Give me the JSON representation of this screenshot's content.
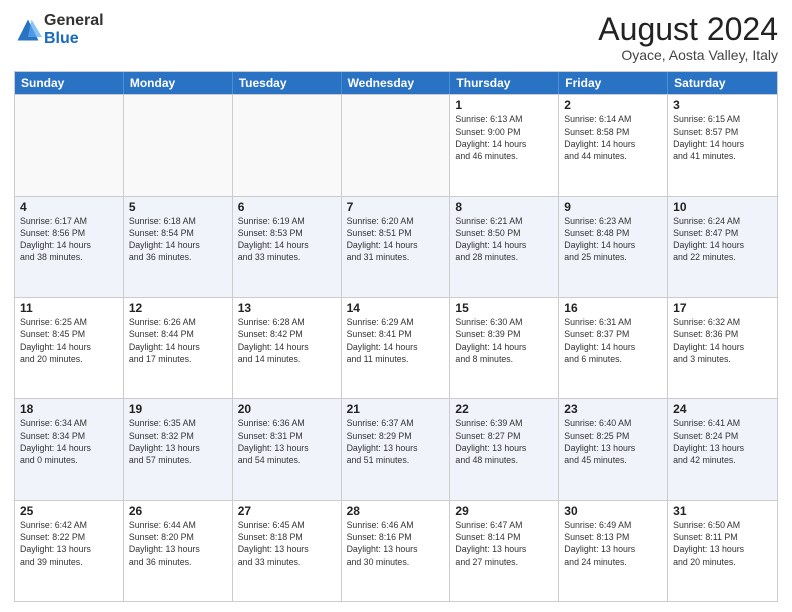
{
  "logo": {
    "general": "General",
    "blue": "Blue"
  },
  "title": "August 2024",
  "subtitle": "Oyace, Aosta Valley, Italy",
  "weekdays": [
    "Sunday",
    "Monday",
    "Tuesday",
    "Wednesday",
    "Thursday",
    "Friday",
    "Saturday"
  ],
  "rows": [
    [
      {
        "day": "",
        "info": "",
        "empty": true
      },
      {
        "day": "",
        "info": "",
        "empty": true
      },
      {
        "day": "",
        "info": "",
        "empty": true
      },
      {
        "day": "",
        "info": "",
        "empty": true
      },
      {
        "day": "1",
        "info": "Sunrise: 6:13 AM\nSunset: 9:00 PM\nDaylight: 14 hours\nand 46 minutes."
      },
      {
        "day": "2",
        "info": "Sunrise: 6:14 AM\nSunset: 8:58 PM\nDaylight: 14 hours\nand 44 minutes."
      },
      {
        "day": "3",
        "info": "Sunrise: 6:15 AM\nSunset: 8:57 PM\nDaylight: 14 hours\nand 41 minutes."
      }
    ],
    [
      {
        "day": "4",
        "info": "Sunrise: 6:17 AM\nSunset: 8:56 PM\nDaylight: 14 hours\nand 38 minutes."
      },
      {
        "day": "5",
        "info": "Sunrise: 6:18 AM\nSunset: 8:54 PM\nDaylight: 14 hours\nand 36 minutes."
      },
      {
        "day": "6",
        "info": "Sunrise: 6:19 AM\nSunset: 8:53 PM\nDaylight: 14 hours\nand 33 minutes."
      },
      {
        "day": "7",
        "info": "Sunrise: 6:20 AM\nSunset: 8:51 PM\nDaylight: 14 hours\nand 31 minutes."
      },
      {
        "day": "8",
        "info": "Sunrise: 6:21 AM\nSunset: 8:50 PM\nDaylight: 14 hours\nand 28 minutes."
      },
      {
        "day": "9",
        "info": "Sunrise: 6:23 AM\nSunset: 8:48 PM\nDaylight: 14 hours\nand 25 minutes."
      },
      {
        "day": "10",
        "info": "Sunrise: 6:24 AM\nSunset: 8:47 PM\nDaylight: 14 hours\nand 22 minutes."
      }
    ],
    [
      {
        "day": "11",
        "info": "Sunrise: 6:25 AM\nSunset: 8:45 PM\nDaylight: 14 hours\nand 20 minutes."
      },
      {
        "day": "12",
        "info": "Sunrise: 6:26 AM\nSunset: 8:44 PM\nDaylight: 14 hours\nand 17 minutes."
      },
      {
        "day": "13",
        "info": "Sunrise: 6:28 AM\nSunset: 8:42 PM\nDaylight: 14 hours\nand 14 minutes."
      },
      {
        "day": "14",
        "info": "Sunrise: 6:29 AM\nSunset: 8:41 PM\nDaylight: 14 hours\nand 11 minutes."
      },
      {
        "day": "15",
        "info": "Sunrise: 6:30 AM\nSunset: 8:39 PM\nDaylight: 14 hours\nand 8 minutes."
      },
      {
        "day": "16",
        "info": "Sunrise: 6:31 AM\nSunset: 8:37 PM\nDaylight: 14 hours\nand 6 minutes."
      },
      {
        "day": "17",
        "info": "Sunrise: 6:32 AM\nSunset: 8:36 PM\nDaylight: 14 hours\nand 3 minutes."
      }
    ],
    [
      {
        "day": "18",
        "info": "Sunrise: 6:34 AM\nSunset: 8:34 PM\nDaylight: 14 hours\nand 0 minutes."
      },
      {
        "day": "19",
        "info": "Sunrise: 6:35 AM\nSunset: 8:32 PM\nDaylight: 13 hours\nand 57 minutes."
      },
      {
        "day": "20",
        "info": "Sunrise: 6:36 AM\nSunset: 8:31 PM\nDaylight: 13 hours\nand 54 minutes."
      },
      {
        "day": "21",
        "info": "Sunrise: 6:37 AM\nSunset: 8:29 PM\nDaylight: 13 hours\nand 51 minutes."
      },
      {
        "day": "22",
        "info": "Sunrise: 6:39 AM\nSunset: 8:27 PM\nDaylight: 13 hours\nand 48 minutes."
      },
      {
        "day": "23",
        "info": "Sunrise: 6:40 AM\nSunset: 8:25 PM\nDaylight: 13 hours\nand 45 minutes."
      },
      {
        "day": "24",
        "info": "Sunrise: 6:41 AM\nSunset: 8:24 PM\nDaylight: 13 hours\nand 42 minutes."
      }
    ],
    [
      {
        "day": "25",
        "info": "Sunrise: 6:42 AM\nSunset: 8:22 PM\nDaylight: 13 hours\nand 39 minutes."
      },
      {
        "day": "26",
        "info": "Sunrise: 6:44 AM\nSunset: 8:20 PM\nDaylight: 13 hours\nand 36 minutes."
      },
      {
        "day": "27",
        "info": "Sunrise: 6:45 AM\nSunset: 8:18 PM\nDaylight: 13 hours\nand 33 minutes."
      },
      {
        "day": "28",
        "info": "Sunrise: 6:46 AM\nSunset: 8:16 PM\nDaylight: 13 hours\nand 30 minutes."
      },
      {
        "day": "29",
        "info": "Sunrise: 6:47 AM\nSunset: 8:14 PM\nDaylight: 13 hours\nand 27 minutes."
      },
      {
        "day": "30",
        "info": "Sunrise: 6:49 AM\nSunset: 8:13 PM\nDaylight: 13 hours\nand 24 minutes."
      },
      {
        "day": "31",
        "info": "Sunrise: 6:50 AM\nSunset: 8:11 PM\nDaylight: 13 hours\nand 20 minutes."
      }
    ]
  ]
}
